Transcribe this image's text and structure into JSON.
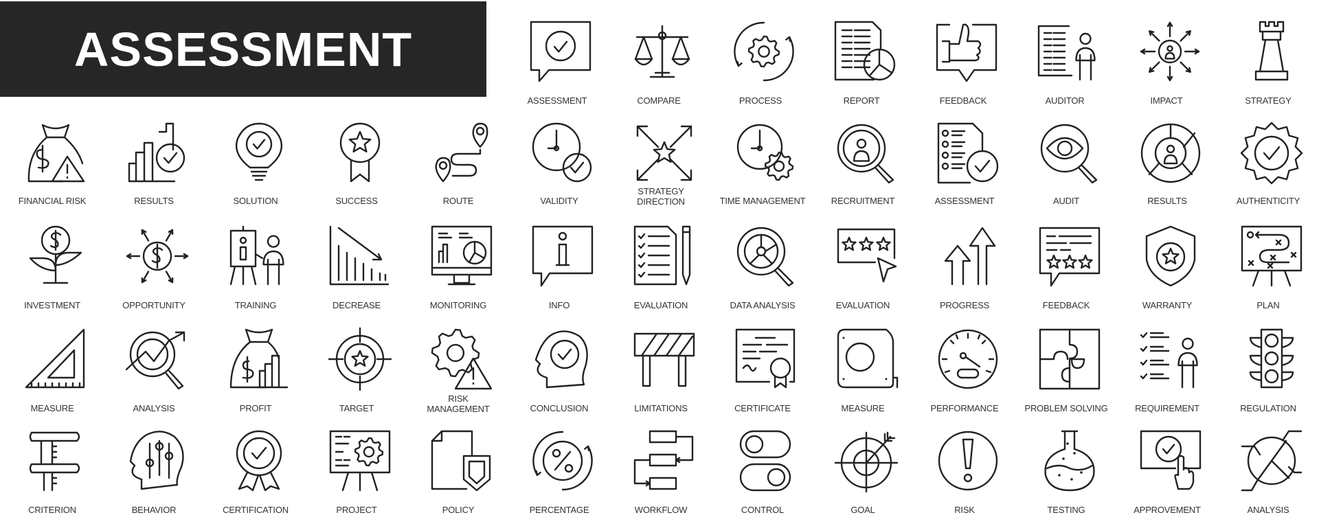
{
  "banner": {
    "title": "ASSESSMENT"
  },
  "colors": {
    "banner_bg": "#262626",
    "banner_text": "#ffffff",
    "icon_stroke": "#222222",
    "background": "#ffffff"
  },
  "rows": [
    [
      {
        "label": "ASSESSMENT",
        "icon": "speech-bubble-check-icon"
      },
      {
        "label": "COMPARE",
        "icon": "scales-icon"
      },
      {
        "label": "PROCESS",
        "icon": "gear-cycle-icon"
      },
      {
        "label": "REPORT",
        "icon": "document-pie-chart-icon"
      },
      {
        "label": "FEEDBACK",
        "icon": "thumbs-up-bubble-icon"
      },
      {
        "label": "AUDITOR",
        "icon": "person-document-icon"
      },
      {
        "label": "IMPACT",
        "icon": "person-arrows-icon"
      },
      {
        "label": "STRATEGY",
        "icon": "chess-rook-icon"
      }
    ],
    [
      {
        "label": "FINANCIAL RISK",
        "icon": "money-bag-warning-icon"
      },
      {
        "label": "RESULTS",
        "icon": "bar-chart-check-icon"
      },
      {
        "label": "SOLUTION",
        "icon": "lightbulb-check-icon"
      },
      {
        "label": "SUCCESS",
        "icon": "star-badge-icon"
      },
      {
        "label": "ROUTE",
        "icon": "route-pins-icon"
      },
      {
        "label": "VALIDITY",
        "icon": "clock-check-icon"
      },
      {
        "label": "STRATEGY DIRECTION",
        "icon": "star-arrows-icon"
      },
      {
        "label": "TIME MANAGEMENT",
        "icon": "clock-gear-icon"
      },
      {
        "label": "RECRUITMENT",
        "icon": "magnifier-person-icon"
      },
      {
        "label": "ASSESSMENT",
        "icon": "checklist-check-icon"
      },
      {
        "label": "AUDIT",
        "icon": "magnifier-eye-icon"
      },
      {
        "label": "RESULTS",
        "icon": "person-pie-icon"
      },
      {
        "label": "AUTHENTICITY",
        "icon": "seal-check-icon"
      }
    ],
    [
      {
        "label": "INVESTMENT",
        "icon": "dollar-plant-icon"
      },
      {
        "label": "OPPORTUNITY",
        "icon": "dollar-arrows-icon"
      },
      {
        "label": "TRAINING",
        "icon": "presenter-board-icon"
      },
      {
        "label": "DECREASE",
        "icon": "decreasing-chart-icon"
      },
      {
        "label": "MONITORING",
        "icon": "monitor-charts-icon"
      },
      {
        "label": "INFO",
        "icon": "info-bubble-icon"
      },
      {
        "label": "EVALUATION",
        "icon": "checklist-pencil-icon"
      },
      {
        "label": "DATA ANALYSIS",
        "icon": "magnifier-pie-icon"
      },
      {
        "label": "EVALUATION",
        "icon": "stars-cursor-icon"
      },
      {
        "label": "PROGRESS",
        "icon": "up-arrows-icon"
      },
      {
        "label": "FEEDBACK",
        "icon": "stars-bubble-icon"
      },
      {
        "label": "WARRANTY",
        "icon": "shield-star-icon"
      },
      {
        "label": "PLAN",
        "icon": "tactics-board-icon"
      }
    ],
    [
      {
        "label": "MEASURE",
        "icon": "set-square-icon"
      },
      {
        "label": "ANALYSIS",
        "icon": "magnifier-trend-icon"
      },
      {
        "label": "PROFIT",
        "icon": "money-bag-chart-icon"
      },
      {
        "label": "TARGET",
        "icon": "crosshair-star-icon"
      },
      {
        "label": "RISK MANAGEMENT",
        "icon": "gear-warning-icon"
      },
      {
        "label": "CONCLUSION",
        "icon": "head-check-icon"
      },
      {
        "label": "LIMITATIONS",
        "icon": "barrier-icon"
      },
      {
        "label": "CERTIFICATE",
        "icon": "certificate-icon"
      },
      {
        "label": "MEASURE",
        "icon": "tape-measure-icon"
      },
      {
        "label": "PERFORMANCE",
        "icon": "speedometer-icon"
      },
      {
        "label": "PROBLEM SOLVING",
        "icon": "puzzle-icon"
      },
      {
        "label": "REQUIREMENT",
        "icon": "person-checklist-icon"
      },
      {
        "label": "REGULATION",
        "icon": "traffic-light-icon"
      }
    ],
    [
      {
        "label": "CRITERION",
        "icon": "caliper-icon"
      },
      {
        "label": "BEHAVIOR",
        "icon": "head-sliders-icon"
      },
      {
        "label": "CERTIFICATION",
        "icon": "rosette-check-icon"
      },
      {
        "label": "PROJECT",
        "icon": "board-gear-icon"
      },
      {
        "label": "POLICY",
        "icon": "document-shield-icon"
      },
      {
        "label": "PERCENTAGE",
        "icon": "percent-cycle-icon"
      },
      {
        "label": "WORKFLOW",
        "icon": "flowchart-icon"
      },
      {
        "label": "CONTROL",
        "icon": "toggles-icon"
      },
      {
        "label": "GOAL",
        "icon": "target-arrow-icon"
      },
      {
        "label": "RISK",
        "icon": "exclamation-circle-icon"
      },
      {
        "label": "TESTING",
        "icon": "flask-icon"
      },
      {
        "label": "APPROVEMENT",
        "icon": "touch-check-icon"
      },
      {
        "label": "ANALYSIS",
        "icon": "pie-lines-icon"
      }
    ]
  ]
}
